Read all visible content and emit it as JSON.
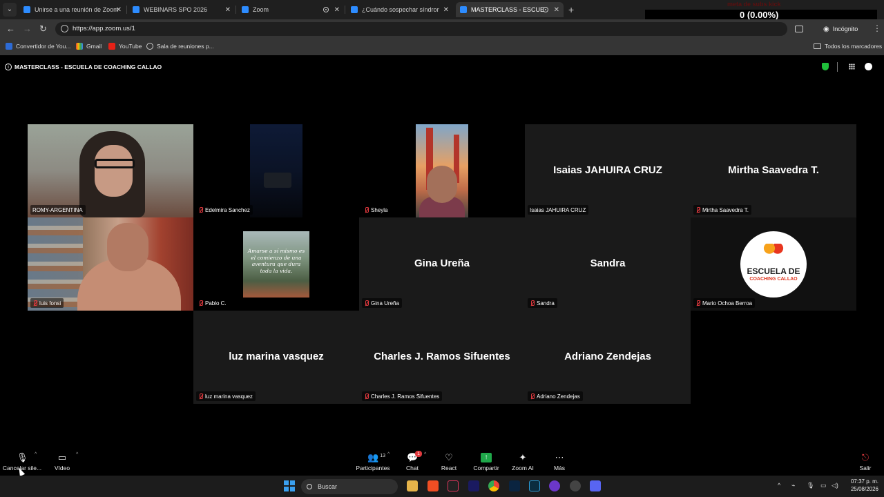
{
  "browser": {
    "tabs": [
      {
        "title": "Unirse a una reunión de Zoom"
      },
      {
        "title": "WEBINARS SPO 2026"
      },
      {
        "title": "Zoom"
      },
      {
        "title": "¿Cuándo sospechar síndrome m"
      },
      {
        "title": "MASTERCLASS - ESCUELA I"
      }
    ],
    "url": "https://app.zoom.us/1",
    "incognito_label": "Incógnito",
    "bookmarks": [
      "Convertidor de You...",
      "Gmail",
      "YouTube",
      "Sala de reuniones p..."
    ],
    "all_bookmarks_label": "Todos los marcadores"
  },
  "stream_overlay": {
    "title": "meta de subs kick",
    "value": "0 (0.00%)",
    "count": "0"
  },
  "meeting": {
    "title": "MASTERCLASS - ESCUELA DE COACHING CALLAO"
  },
  "participants": [
    {
      "name": "ROMY-ARGENTINA",
      "display": "",
      "muted": false,
      "video": true
    },
    {
      "name": "Edelmira Sanchez",
      "display": "",
      "muted": true,
      "video": true
    },
    {
      "name": "Sheyla",
      "display": "",
      "muted": true,
      "video": true
    },
    {
      "name": "Isaias JAHUIRA CRUZ",
      "display": "Isaias JAHUIRA CRUZ",
      "muted": false,
      "video": false
    },
    {
      "name": "Mirtha Saavedra T.",
      "display": "Mirtha Saavedra T.",
      "muted": true,
      "video": false
    },
    {
      "name": "luis fonsi",
      "display": "",
      "muted": true,
      "video": true
    },
    {
      "name": "Pablo C.",
      "display": "",
      "muted": true,
      "video": true,
      "quote": "Amarse a sí mismo es el comienzo de una aventura que dura toda la vida."
    },
    {
      "name": "Gina Ureña",
      "display": "Gina Ureña",
      "muted": true,
      "video": false
    },
    {
      "name": "Sandra",
      "display": "Sandra",
      "muted": true,
      "video": false
    },
    {
      "name": "Mario Ochoa Berroa",
      "display": "",
      "muted": true,
      "video": true,
      "logo_line1": "ESCUELA DE",
      "logo_line2": "COACHING CALLAO"
    },
    {
      "name": "luz marina vasquez",
      "display": "luz marina vasquez",
      "muted": true,
      "video": false
    },
    {
      "name": "Charles J. Ramos Sifuentes",
      "display": "Charles J. Ramos Sifuentes",
      "muted": true,
      "video": false
    },
    {
      "name": "Adriano Zendejas",
      "display": "Adriano Zendejas",
      "muted": true,
      "video": false
    }
  ],
  "controls": {
    "mute_label": "Cancelar sile...",
    "video_label": "Vídeo",
    "participants_label": "Participantes",
    "participants_count": "13",
    "chat_label": "Chat",
    "chat_badge": "1",
    "react_label": "React",
    "share_label": "Compartir",
    "ai_label": "Zoom AI",
    "more_label": "Más",
    "leave_label": "Salir"
  },
  "taskbar": {
    "search_placeholder": "Buscar",
    "time": "07:37 p. m.",
    "date": "25/08/2026"
  },
  "colors": {
    "speaking_border": "#53d453",
    "muted_icon": "#e0393e",
    "secure_shield": "#1fbf3a",
    "share_button": "#1fa84a"
  }
}
